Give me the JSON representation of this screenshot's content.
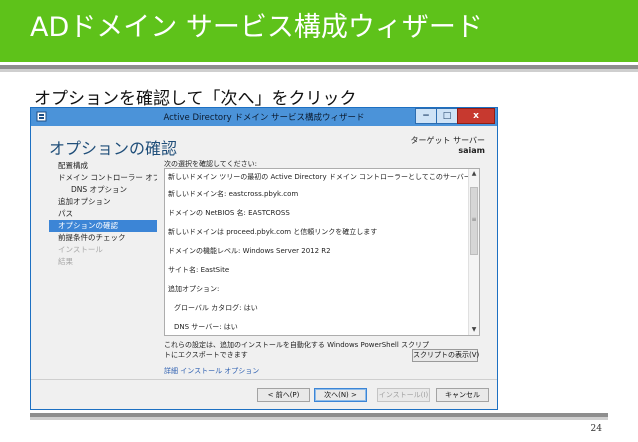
{
  "slide": {
    "title": "ADドメイン サービス構成ウィザード",
    "instruction": "オプションを確認して「次へ」をクリック",
    "page_number": "24"
  },
  "colors": {
    "header_green": "#5ec21a",
    "titlebar_blue": "#4b93d9",
    "nav_active": "#3c85d6",
    "close_red": "#c7392f",
    "link_blue": "#2d5fb1"
  },
  "window": {
    "title": "Active Directory ドメイン サービス構成ウィザード",
    "app_icon": "server-manager-icon",
    "controls": {
      "minimize": "−",
      "maximize": "□",
      "close": "x"
    },
    "page_heading": "オプションの確認",
    "target_server_label": "ターゲット サーバー",
    "target_server_value": "saiam"
  },
  "nav": {
    "items": [
      {
        "label": "配置構成",
        "state": "normal"
      },
      {
        "label": "ドメイン コントローラー オプ…",
        "state": "normal"
      },
      {
        "label": "DNS オプション",
        "state": "normal"
      },
      {
        "label": "追加オプション",
        "state": "normal"
      },
      {
        "label": "パス",
        "state": "normal"
      },
      {
        "label": "オプションの確認",
        "state": "active"
      },
      {
        "label": "前提条件のチェック",
        "state": "normal"
      },
      {
        "label": "インストール",
        "state": "disabled"
      },
      {
        "label": "結果",
        "state": "disabled"
      }
    ]
  },
  "content": {
    "intro": "次の選択を確認してください:",
    "review_lines": [
      "新しいドメイン ツリーの最初の Active Directory ドメイン コントローラーとしてこのサーバーを構成します。",
      "新しいドメイン名: eastcross.pbyk.com",
      "ドメインの NetBIOS 名: EASTCROSS",
      "新しいドメインは proceed.pbyk.com と信頼リンクを確立します",
      "ドメインの機能レベル: Windows Server 2012 R2",
      "サイト名: EastSite",
      "追加オプション:",
      "グローバル カタログ: はい",
      "DNS サーバー: はい"
    ],
    "scroll_up": "▲",
    "scroll_down": "▼",
    "scroll_grip": "≡",
    "export_text": "これらの設定は、追加のインストールを自動化する Windows PowerShell スクリプトにエクスポートできます",
    "script_button": "スクリプトの表示(V)",
    "more_link": "詳細 インストール オプション"
  },
  "buttons": {
    "prev": "< 前へ(P)",
    "next": "次へ(N) >",
    "install": "インストール(I)",
    "cancel": "キャンセル"
  }
}
